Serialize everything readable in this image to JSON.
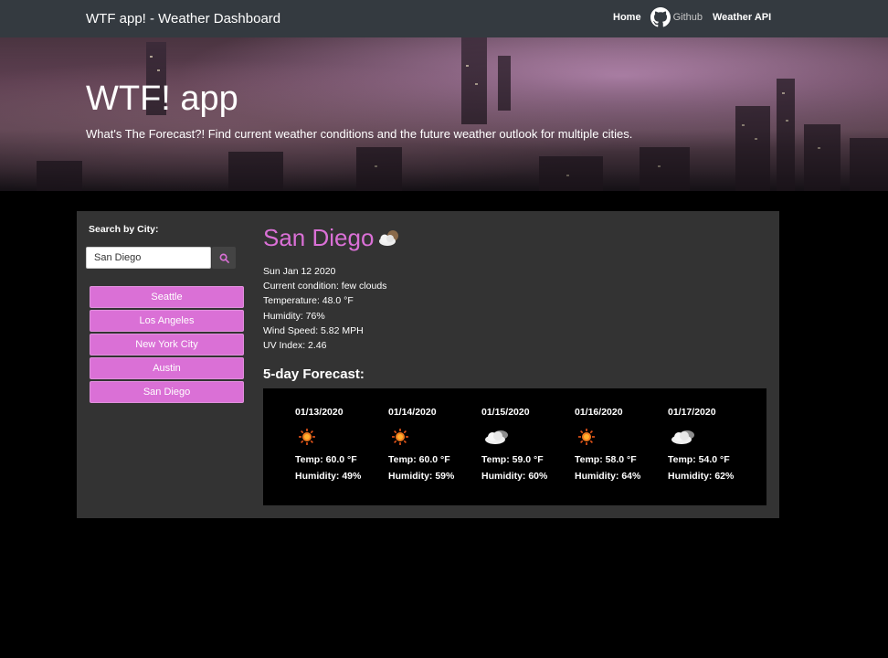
{
  "navbar": {
    "brand": "WTF app! - Weather Dashboard",
    "links": [
      {
        "label": "Home"
      },
      {
        "label": "Github",
        "icon": "github-icon"
      },
      {
        "label": "Weather API"
      }
    ]
  },
  "hero": {
    "title": "WTF! app",
    "subtitle": "What's The Forecast?! Find current weather conditions and the future weather outlook for multiple cities."
  },
  "search": {
    "label": "Search by City:",
    "value": "San Diego",
    "button_icon": "search-icon"
  },
  "cities": [
    "Seattle",
    "Los Angeles",
    "New York City",
    "Austin",
    "San Diego"
  ],
  "current": {
    "city": "San Diego",
    "icon": "few-clouds-night-icon",
    "date": "Sun Jan 12 2020",
    "condition": "Current condition: few clouds",
    "temperature": "Temperature: 48.0 °F",
    "humidity": "Humidity: 76%",
    "wind": "Wind Speed: 5.82 MPH",
    "uv": "UV Index: 2.46"
  },
  "forecast": {
    "title": "5-day Forecast:",
    "days": [
      {
        "date": "01/13/2020",
        "icon": "sun-icon",
        "temp": "Temp: 60.0 °F",
        "humidity": "Humidity: 49%"
      },
      {
        "date": "01/14/2020",
        "icon": "sun-icon",
        "temp": "Temp: 60.0 °F",
        "humidity": "Humidity: 59%"
      },
      {
        "date": "01/15/2020",
        "icon": "cloud-icon",
        "temp": "Temp: 59.0 °F",
        "humidity": "Humidity: 60%"
      },
      {
        "date": "01/16/2020",
        "icon": "sun-icon",
        "temp": "Temp: 58.0 °F",
        "humidity": "Humidity: 64%"
      },
      {
        "date": "01/17/2020",
        "icon": "cloud-icon",
        "temp": "Temp: 54.0 °F",
        "humidity": "Humidity: 62%"
      }
    ]
  },
  "colors": {
    "accent": "#da70d6",
    "navbar": "#343a40",
    "panel": "#333333",
    "page": "#000000"
  }
}
